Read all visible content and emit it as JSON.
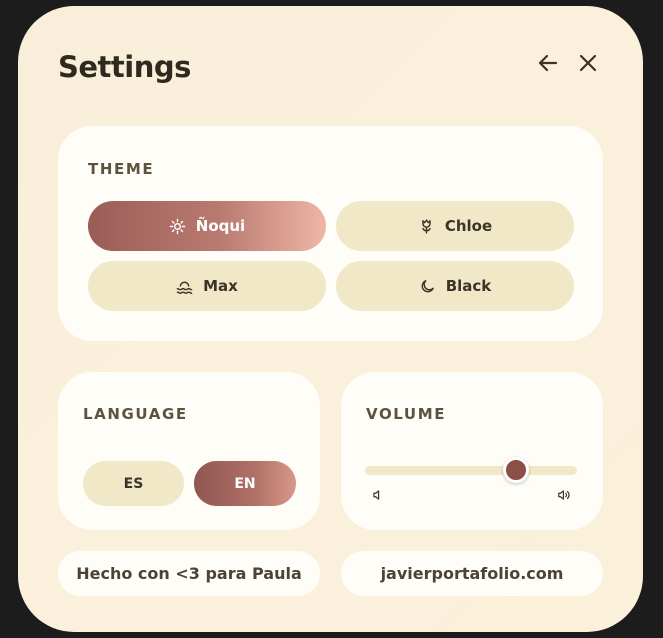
{
  "header": {
    "title": "Settings",
    "back_icon": "arrow-left-icon",
    "close_icon": "close-icon"
  },
  "theme": {
    "label": "THEME",
    "options": [
      {
        "label": "Ñoqui",
        "icon": "sun-icon",
        "active": true
      },
      {
        "label": "Chloe",
        "icon": "flower-icon",
        "active": false
      },
      {
        "label": "Max",
        "icon": "waves-icon",
        "active": false
      },
      {
        "label": "Black",
        "icon": "moon-icon",
        "active": false
      }
    ]
  },
  "language": {
    "label": "LANGUAGE",
    "options": [
      {
        "label": "ES",
        "active": false
      },
      {
        "label": "EN",
        "active": true
      }
    ]
  },
  "volume": {
    "label": "VOLUME",
    "level": 0.71
  },
  "footer": {
    "credit": "Hecho con <3 para Paula",
    "link": "javierportafolio.com"
  },
  "colors": {
    "accent": "#8b4f47",
    "chip": "#f1e8c8",
    "card": "#fffdf8",
    "background": "#faf0dc"
  }
}
